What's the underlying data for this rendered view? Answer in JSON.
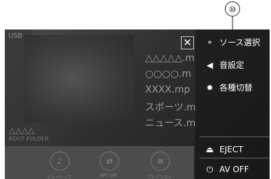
{
  "callout": {
    "number": "⑩"
  },
  "player": {
    "source_label": "USB",
    "tracks": [
      "△△△△△.m",
      "○○○○.m",
      "XXXX.mp",
      "スポーツ.m",
      "ニュース.m"
    ],
    "artist": "△△△△",
    "folder": "ROOT FOLDER",
    "controls": [
      {
        "label": "ミュージック",
        "icon": "music-note-icon",
        "glyph": "♪"
      },
      {
        "label": "RPT OFF",
        "icon": "repeat-icon",
        "glyph": "⇄"
      },
      {
        "label": "プレイリスト",
        "icon": "playlist-icon",
        "glyph": "≡"
      }
    ]
  },
  "menu": {
    "close_glyph": "✕",
    "items": [
      {
        "label": "ソース選択",
        "icon": "source-select-icon",
        "glyph": "⚬"
      },
      {
        "label": "音設定",
        "icon": "speaker-icon",
        "glyph": "◀"
      },
      {
        "label": "各種切替",
        "icon": "gear-icon",
        "glyph": "✹"
      }
    ],
    "eject_label": "EJECT",
    "eject_glyph": "⏏",
    "av_off_label": "AV OFF",
    "av_off_glyph": "⏻"
  }
}
